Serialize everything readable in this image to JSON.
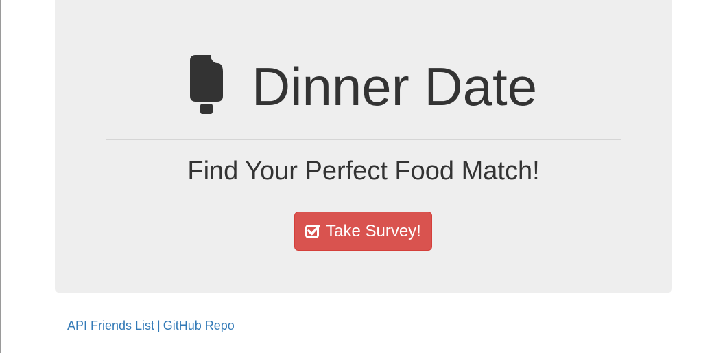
{
  "header": {
    "logo_icon": "popsicle-icon",
    "title": "Dinner Date",
    "subtitle": "Find Your Perfect Food Match!"
  },
  "survey_button": {
    "icon": "check-square-icon",
    "label": "Take Survey!",
    "color": "#d9534f"
  },
  "footer": {
    "links": [
      {
        "label": "API Friends List"
      },
      {
        "label": "GitHub Repo"
      }
    ],
    "separator": "|",
    "link_color": "#337ab7"
  }
}
